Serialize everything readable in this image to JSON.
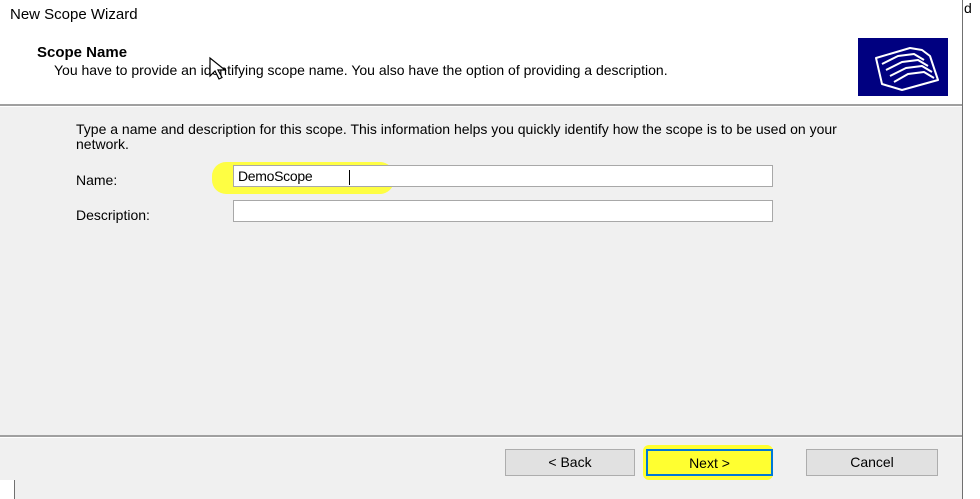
{
  "window": {
    "title": "New Scope Wizard"
  },
  "header": {
    "title": "Scope Name",
    "subtitle": "You have to provide an identifying scope name. You also have the option of providing a description."
  },
  "icons": {
    "wizard": "folders-icon",
    "cursor": "mouse-pointer-icon"
  },
  "body": {
    "intro": "Type a name and description for this scope. This information helps you quickly identify how the scope is to be used on your network.",
    "name_label": "Name:",
    "name_value": "DemoScope",
    "description_label": "Description:",
    "description_value": ""
  },
  "buttons": {
    "back": "< Back",
    "next": "Next >",
    "cancel": "Cancel"
  },
  "edge": {
    "cut_letter": "d"
  },
  "colors": {
    "highlight": "#ffff30",
    "focus": "#0078d7",
    "icon_bg": "#000080"
  }
}
